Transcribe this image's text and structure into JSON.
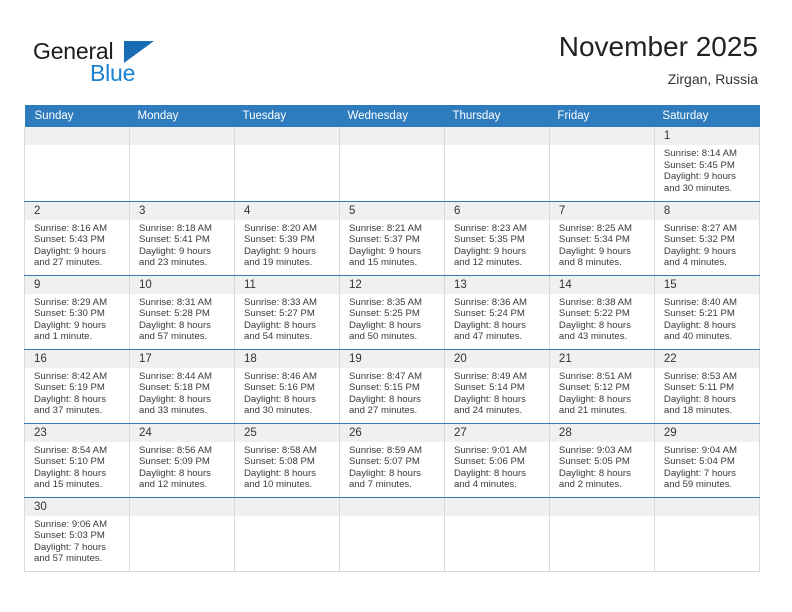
{
  "brand": {
    "name_top": "General",
    "name_bottom": "Blue",
    "triangle_color": "#1a6cb5",
    "blue_color": "#1a80d0"
  },
  "header": {
    "title": "November 2025",
    "subtitle": "Zirgan, Russia",
    "header_bg": "#2e7cbe",
    "row_divider": "#3b77b5",
    "daynum_bg": "#f0f0f0"
  },
  "weekdays": [
    "Sunday",
    "Monday",
    "Tuesday",
    "Wednesday",
    "Thursday",
    "Friday",
    "Saturday"
  ],
  "labels": {
    "sunrise": "Sunrise:",
    "sunset": "Sunset:",
    "daylight": "Daylight:"
  },
  "weeks": [
    [
      {
        "blank": true
      },
      {
        "blank": true
      },
      {
        "blank": true
      },
      {
        "blank": true
      },
      {
        "blank": true
      },
      {
        "blank": true
      },
      {
        "day": "1",
        "sunrise": "Sunrise: 8:14 AM",
        "sunset": "Sunset: 5:45 PM",
        "daylight_1": "Daylight: 9 hours",
        "daylight_2": "and 30 minutes."
      }
    ],
    [
      {
        "day": "2",
        "sunrise": "Sunrise: 8:16 AM",
        "sunset": "Sunset: 5:43 PM",
        "daylight_1": "Daylight: 9 hours",
        "daylight_2": "and 27 minutes."
      },
      {
        "day": "3",
        "sunrise": "Sunrise: 8:18 AM",
        "sunset": "Sunset: 5:41 PM",
        "daylight_1": "Daylight: 9 hours",
        "daylight_2": "and 23 minutes."
      },
      {
        "day": "4",
        "sunrise": "Sunrise: 8:20 AM",
        "sunset": "Sunset: 5:39 PM",
        "daylight_1": "Daylight: 9 hours",
        "daylight_2": "and 19 minutes."
      },
      {
        "day": "5",
        "sunrise": "Sunrise: 8:21 AM",
        "sunset": "Sunset: 5:37 PM",
        "daylight_1": "Daylight: 9 hours",
        "daylight_2": "and 15 minutes."
      },
      {
        "day": "6",
        "sunrise": "Sunrise: 8:23 AM",
        "sunset": "Sunset: 5:35 PM",
        "daylight_1": "Daylight: 9 hours",
        "daylight_2": "and 12 minutes."
      },
      {
        "day": "7",
        "sunrise": "Sunrise: 8:25 AM",
        "sunset": "Sunset: 5:34 PM",
        "daylight_1": "Daylight: 9 hours",
        "daylight_2": "and 8 minutes."
      },
      {
        "day": "8",
        "sunrise": "Sunrise: 8:27 AM",
        "sunset": "Sunset: 5:32 PM",
        "daylight_1": "Daylight: 9 hours",
        "daylight_2": "and 4 minutes."
      }
    ],
    [
      {
        "day": "9",
        "sunrise": "Sunrise: 8:29 AM",
        "sunset": "Sunset: 5:30 PM",
        "daylight_1": "Daylight: 9 hours",
        "daylight_2": "and 1 minute."
      },
      {
        "day": "10",
        "sunrise": "Sunrise: 8:31 AM",
        "sunset": "Sunset: 5:28 PM",
        "daylight_1": "Daylight: 8 hours",
        "daylight_2": "and 57 minutes."
      },
      {
        "day": "11",
        "sunrise": "Sunrise: 8:33 AM",
        "sunset": "Sunset: 5:27 PM",
        "daylight_1": "Daylight: 8 hours",
        "daylight_2": "and 54 minutes."
      },
      {
        "day": "12",
        "sunrise": "Sunrise: 8:35 AM",
        "sunset": "Sunset: 5:25 PM",
        "daylight_1": "Daylight: 8 hours",
        "daylight_2": "and 50 minutes."
      },
      {
        "day": "13",
        "sunrise": "Sunrise: 8:36 AM",
        "sunset": "Sunset: 5:24 PM",
        "daylight_1": "Daylight: 8 hours",
        "daylight_2": "and 47 minutes."
      },
      {
        "day": "14",
        "sunrise": "Sunrise: 8:38 AM",
        "sunset": "Sunset: 5:22 PM",
        "daylight_1": "Daylight: 8 hours",
        "daylight_2": "and 43 minutes."
      },
      {
        "day": "15",
        "sunrise": "Sunrise: 8:40 AM",
        "sunset": "Sunset: 5:21 PM",
        "daylight_1": "Daylight: 8 hours",
        "daylight_2": "and 40 minutes."
      }
    ],
    [
      {
        "day": "16",
        "sunrise": "Sunrise: 8:42 AM",
        "sunset": "Sunset: 5:19 PM",
        "daylight_1": "Daylight: 8 hours",
        "daylight_2": "and 37 minutes."
      },
      {
        "day": "17",
        "sunrise": "Sunrise: 8:44 AM",
        "sunset": "Sunset: 5:18 PM",
        "daylight_1": "Daylight: 8 hours",
        "daylight_2": "and 33 minutes."
      },
      {
        "day": "18",
        "sunrise": "Sunrise: 8:46 AM",
        "sunset": "Sunset: 5:16 PM",
        "daylight_1": "Daylight: 8 hours",
        "daylight_2": "and 30 minutes."
      },
      {
        "day": "19",
        "sunrise": "Sunrise: 8:47 AM",
        "sunset": "Sunset: 5:15 PM",
        "daylight_1": "Daylight: 8 hours",
        "daylight_2": "and 27 minutes."
      },
      {
        "day": "20",
        "sunrise": "Sunrise: 8:49 AM",
        "sunset": "Sunset: 5:14 PM",
        "daylight_1": "Daylight: 8 hours",
        "daylight_2": "and 24 minutes."
      },
      {
        "day": "21",
        "sunrise": "Sunrise: 8:51 AM",
        "sunset": "Sunset: 5:12 PM",
        "daylight_1": "Daylight: 8 hours",
        "daylight_2": "and 21 minutes."
      },
      {
        "day": "22",
        "sunrise": "Sunrise: 8:53 AM",
        "sunset": "Sunset: 5:11 PM",
        "daylight_1": "Daylight: 8 hours",
        "daylight_2": "and 18 minutes."
      }
    ],
    [
      {
        "day": "23",
        "sunrise": "Sunrise: 8:54 AM",
        "sunset": "Sunset: 5:10 PM",
        "daylight_1": "Daylight: 8 hours",
        "daylight_2": "and 15 minutes."
      },
      {
        "day": "24",
        "sunrise": "Sunrise: 8:56 AM",
        "sunset": "Sunset: 5:09 PM",
        "daylight_1": "Daylight: 8 hours",
        "daylight_2": "and 12 minutes."
      },
      {
        "day": "25",
        "sunrise": "Sunrise: 8:58 AM",
        "sunset": "Sunset: 5:08 PM",
        "daylight_1": "Daylight: 8 hours",
        "daylight_2": "and 10 minutes."
      },
      {
        "day": "26",
        "sunrise": "Sunrise: 8:59 AM",
        "sunset": "Sunset: 5:07 PM",
        "daylight_1": "Daylight: 8 hours",
        "daylight_2": "and 7 minutes."
      },
      {
        "day": "27",
        "sunrise": "Sunrise: 9:01 AM",
        "sunset": "Sunset: 5:06 PM",
        "daylight_1": "Daylight: 8 hours",
        "daylight_2": "and 4 minutes."
      },
      {
        "day": "28",
        "sunrise": "Sunrise: 9:03 AM",
        "sunset": "Sunset: 5:05 PM",
        "daylight_1": "Daylight: 8 hours",
        "daylight_2": "and 2 minutes."
      },
      {
        "day": "29",
        "sunrise": "Sunrise: 9:04 AM",
        "sunset": "Sunset: 5:04 PM",
        "daylight_1": "Daylight: 7 hours",
        "daylight_2": "and 59 minutes."
      }
    ],
    [
      {
        "day": "30",
        "sunrise": "Sunrise: 9:06 AM",
        "sunset": "Sunset: 5:03 PM",
        "daylight_1": "Daylight: 7 hours",
        "daylight_2": "and 57 minutes."
      },
      {
        "blank": true
      },
      {
        "blank": true
      },
      {
        "blank": true
      },
      {
        "blank": true
      },
      {
        "blank": true
      },
      {
        "blank": true
      }
    ]
  ]
}
